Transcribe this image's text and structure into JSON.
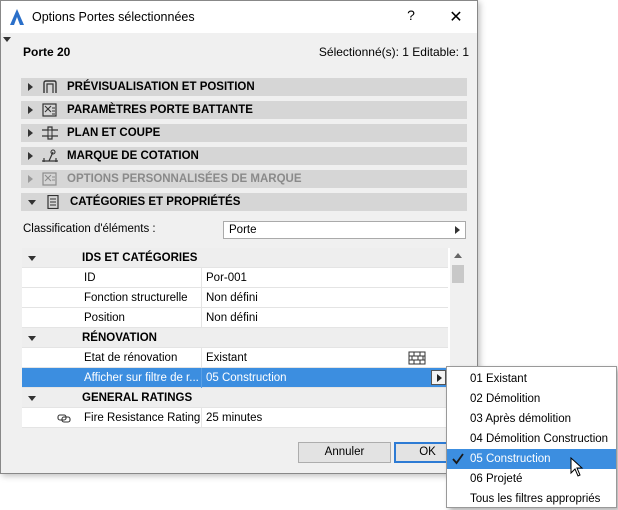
{
  "window": {
    "title": "Options Portes sélectionnées",
    "help_label": "?",
    "close_label": "✕"
  },
  "header": {
    "element_name": "Porte 20",
    "selection_info": "Sélectionné(s): 1 Editable: 1"
  },
  "sections": [
    {
      "label": "PRÉVISUALISATION ET POSITION",
      "icon": "door-preview-icon",
      "expanded": false,
      "enabled": true
    },
    {
      "label": "PARAMÈTRES PORTE BATTANTE",
      "icon": "door-parameters-icon",
      "expanded": false,
      "enabled": true
    },
    {
      "label": "PLAN ET COUPE",
      "icon": "plan-section-icon",
      "expanded": false,
      "enabled": true
    },
    {
      "label": "MARQUE DE COTATION",
      "icon": "dimension-marker-icon",
      "expanded": false,
      "enabled": true
    },
    {
      "label": "OPTIONS PERSONNALISÉES DE MARQUE",
      "icon": "custom-marker-icon",
      "expanded": false,
      "enabled": false
    },
    {
      "label": "CATÉGORIES ET PROPRIÉTÉS",
      "icon": "document-list-icon",
      "expanded": true,
      "enabled": true
    }
  ],
  "classification": {
    "label": "Classification d'éléments :",
    "value": "Porte"
  },
  "properties": {
    "groups": [
      {
        "name": "IDS ET CATÉGORIES"
      },
      {
        "name": "RÉNOVATION"
      },
      {
        "name": "GENERAL RATINGS"
      }
    ],
    "rows": [
      {
        "name": "ID",
        "value": "Por-001"
      },
      {
        "name": "Fonction structurelle",
        "value": "Non défini"
      },
      {
        "name": "Position",
        "value": "Non défini"
      },
      {
        "name": "Etat de rénovation",
        "value": "Existant"
      },
      {
        "name": "Afficher sur filtre de r...",
        "value": "05 Construction"
      },
      {
        "name": "Fire Resistance Rating",
        "value": "25 minutes"
      }
    ]
  },
  "buttons": {
    "cancel": "Annuler",
    "ok": "OK"
  },
  "dropdown": {
    "items": [
      "01 Existant",
      "02 Démolition",
      "03 Après démolition",
      "04 Démolition Construction",
      "05 Construction",
      "06 Projeté",
      "Tous les filtres appropriés"
    ],
    "selected": "05 Construction"
  },
  "colors": {
    "selection": "#3c8ee0",
    "section_bar": "#d6d6d6",
    "ok_border": "#2d7bd4"
  }
}
